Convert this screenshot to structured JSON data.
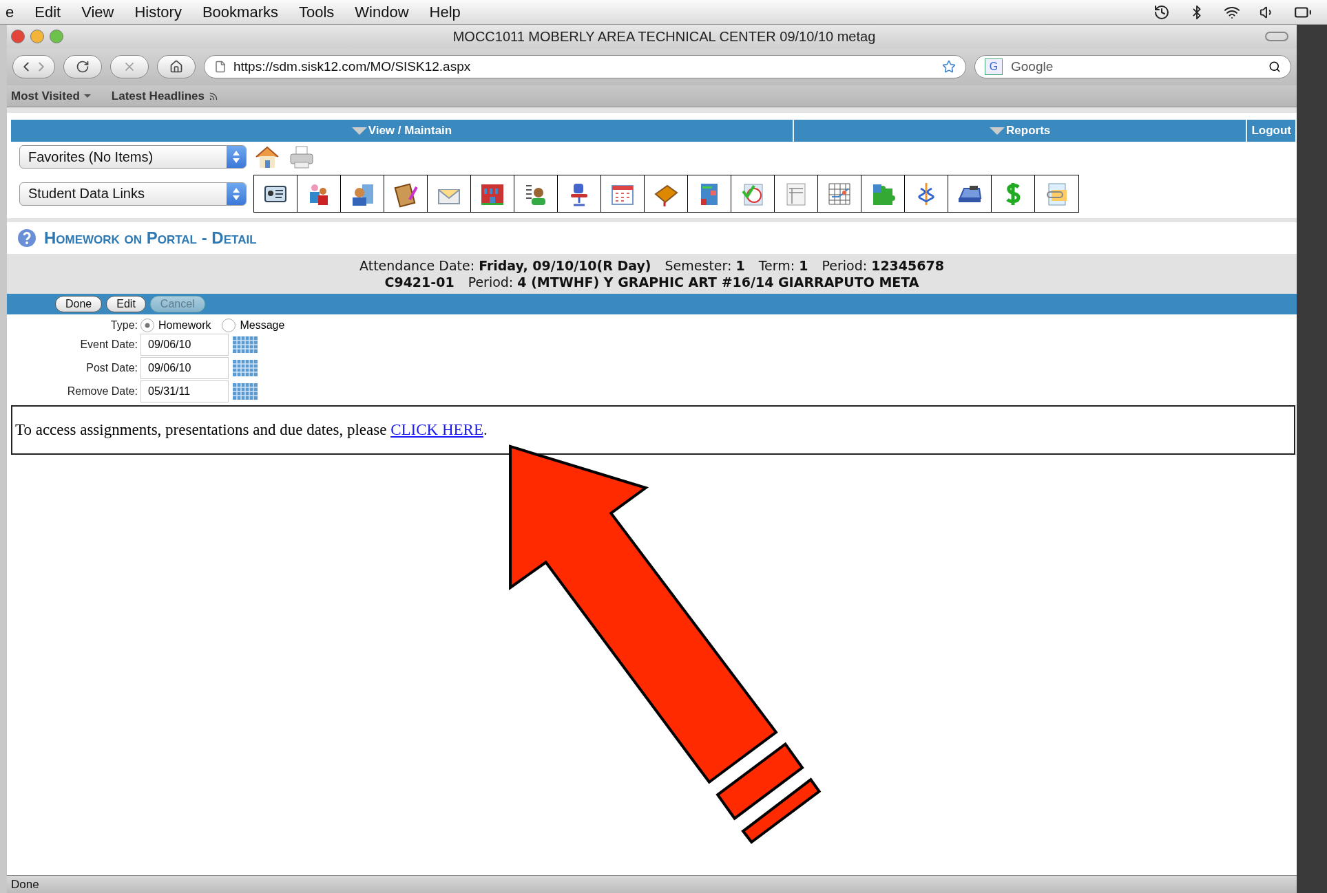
{
  "menu_bar": {
    "items": [
      "e",
      "Edit",
      "View",
      "History",
      "Bookmarks",
      "Tools",
      "Window",
      "Help"
    ]
  },
  "window": {
    "title": "MOCC1011 MOBERLY AREA TECHNICAL CENTER 09/10/10  metag"
  },
  "address_bar": {
    "url": "https://sdm.sisk12.com/MO/SISK12.aspx"
  },
  "search": {
    "engine_badge": "G",
    "placeholder": "Google"
  },
  "bookmarks": [
    {
      "label": "Most Visited",
      "kind": "menu"
    },
    {
      "label": "Latest Headlines",
      "kind": "feed"
    }
  ],
  "app_nav": {
    "tabs": [
      {
        "label": "View / Maintain"
      },
      {
        "label": "Reports"
      }
    ],
    "logout": "Logout"
  },
  "favorites_select": "Favorites (No Items)",
  "links_select": "Student Data Links",
  "page_heading": "Homework on Portal - Detail",
  "info": {
    "line_1": [
      {
        "label": "Attendance Date:",
        "value": "Friday, 09/10/10(R Day)"
      },
      {
        "label": "Semester:",
        "value": "1"
      },
      {
        "label": "Term:",
        "value": "1"
      },
      {
        "label": "Period:",
        "value": "12345678"
      }
    ],
    "course": "C9421-01",
    "period_label": "Period:",
    "period_value": "4 (MTWHF) Y GRAPHIC ART #16/14 GIARRAPUTO META"
  },
  "actions": [
    {
      "label": "Done",
      "disabled": false
    },
    {
      "label": "Edit",
      "disabled": false
    },
    {
      "label": "Cancel",
      "disabled": true
    }
  ],
  "form": {
    "type_label": "Type:",
    "type_options": [
      {
        "label": "Homework",
        "selected": true
      },
      {
        "label": "Message",
        "selected": false
      }
    ],
    "dates": [
      {
        "label": "Event Date:",
        "value": "09/06/10"
      },
      {
        "label": "Post Date:",
        "value": "09/06/10"
      },
      {
        "label": "Remove Date:",
        "value": "05/31/11"
      }
    ]
  },
  "message": {
    "text": "To access assignments, presentations and due dates, please ",
    "link": "CLICK HERE",
    "end": "."
  },
  "status_bar": {
    "text": "Done"
  }
}
